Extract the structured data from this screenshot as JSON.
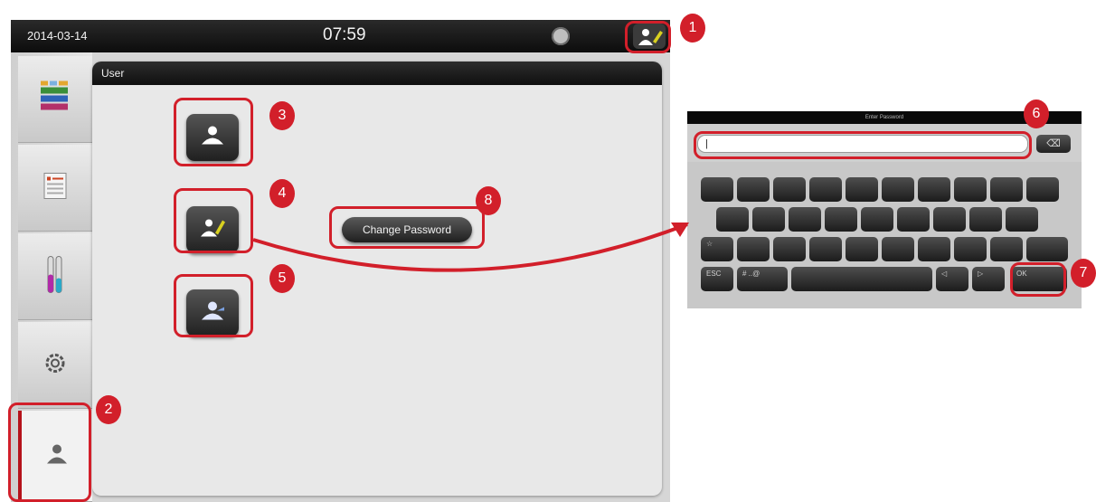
{
  "status_bar": {
    "date": "2014-03-14",
    "time": "07:59",
    "language_icon": "globe-icon",
    "user_icon": "user-supervisor-icon"
  },
  "sidebar": {
    "items": [
      {
        "icon": "station-layout-icon"
      },
      {
        "icon": "program-list-icon"
      },
      {
        "icon": "reagent-icon"
      },
      {
        "icon": "settings-gear-icon"
      },
      {
        "icon": "user-icon",
        "active": true
      }
    ]
  },
  "panel": {
    "title": "User",
    "buttons": [
      {
        "icon": "standard-user-icon"
      },
      {
        "icon": "supervisor-user-icon"
      },
      {
        "icon": "service-user-icon"
      }
    ],
    "change_password_label": "Change Password"
  },
  "keyboard": {
    "title": "Enter Password",
    "input_value": "|",
    "keys_row4": {
      "esc": "ESC",
      "mode": "# ..@",
      "left": "◁",
      "right": "▷",
      "ok": "OK"
    }
  },
  "callouts": {
    "c1": "1",
    "c2": "2",
    "c3": "3",
    "c4": "4",
    "c5": "5",
    "c6": "6",
    "c7": "7",
    "c8": "8"
  },
  "colors": {
    "highlight": "#d21f2a",
    "active_tab": "#b5121b"
  }
}
